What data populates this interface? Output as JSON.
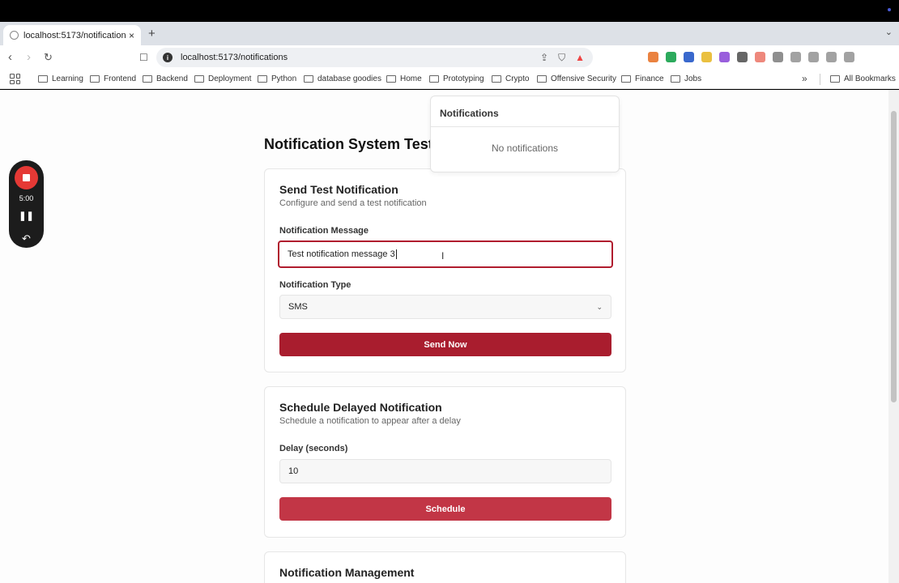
{
  "browser": {
    "tab_title": "localhost:5173/notifications",
    "tab_close": "×",
    "new_tab": "+",
    "url": "localhost:5173/notifications",
    "bookmarks": [
      "Learning",
      "Frontend",
      "Backend",
      "Deployment",
      "Python",
      "database goodies",
      "Home",
      "Prototyping",
      "Crypto",
      "Offensive Security",
      "Finance",
      "Jobs"
    ],
    "bookmarks_more": "»",
    "all_bookmarks": "All Bookmarks",
    "ext_colors": [
      "#e8742b",
      "#15a14a",
      "#2458c8",
      "#e8b92b",
      "#8e4ed8",
      "#555555",
      "#ec7b6e",
      "#333333",
      "#555555",
      "#555555",
      "#555555",
      "#555555"
    ]
  },
  "recorder": {
    "timer": "5:00",
    "pause_glyph": "❚❚",
    "undo_glyph": "↶"
  },
  "page": {
    "title": "Notification System Test"
  },
  "notifications_popover": {
    "header": "Notifications",
    "empty_text": "No notifications"
  },
  "send_card": {
    "title": "Send Test Notification",
    "description": "Configure and send a test notification",
    "message_label": "Notification Message",
    "message_value": "Test notification message 3",
    "type_label": "Notification Type",
    "type_value": "SMS",
    "send_button": "Send Now"
  },
  "schedule_card": {
    "title": "Schedule Delayed Notification",
    "description": "Schedule a notification to appear after a delay",
    "delay_label": "Delay (seconds)",
    "delay_value": "10",
    "schedule_button": "Schedule"
  },
  "management_card": {
    "title": "Notification Management"
  }
}
